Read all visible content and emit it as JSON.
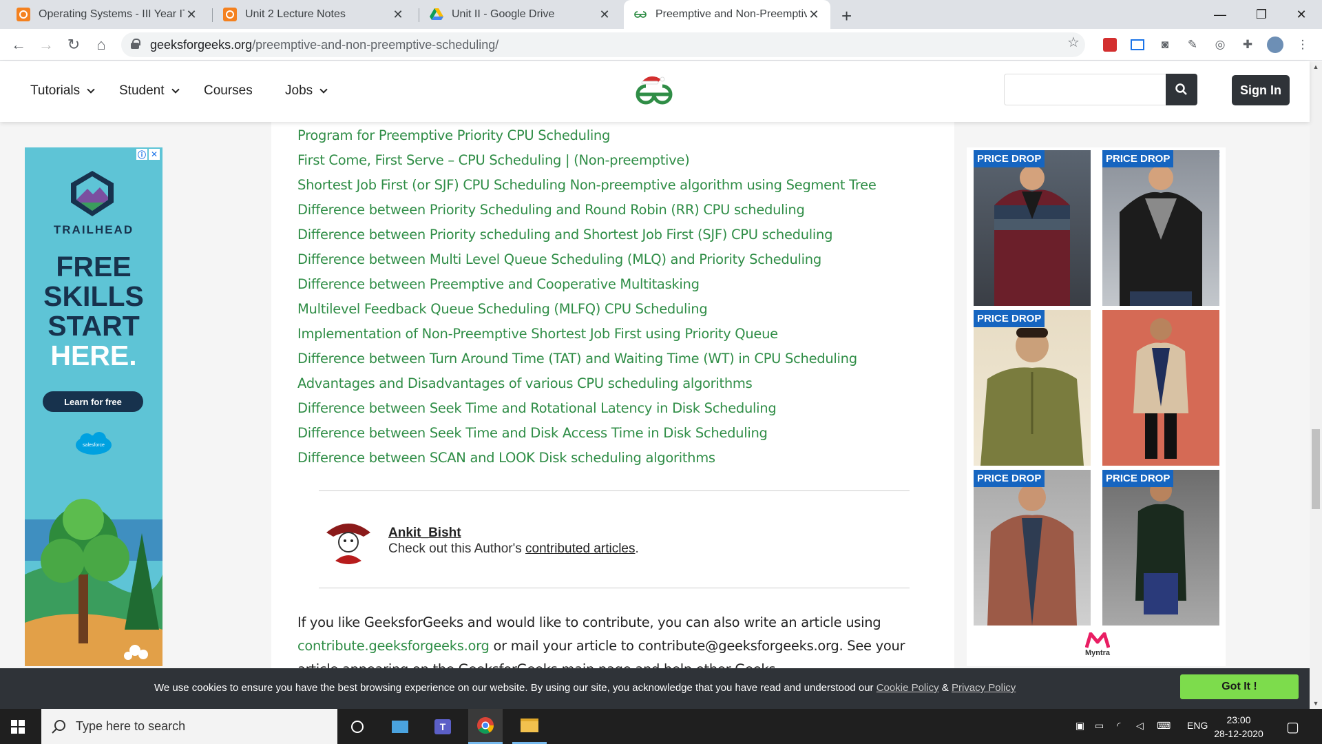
{
  "browser": {
    "tabs": [
      {
        "title": "Operating Systems - III Year IT (B",
        "icon": "classroom-icon"
      },
      {
        "title": "Unit 2 Lecture Notes",
        "icon": "classroom-icon"
      },
      {
        "title": "Unit II - Google Drive",
        "icon": "drive-icon"
      },
      {
        "title": "Preemptive and Non-Preemptive",
        "icon": "gfg-icon",
        "active": true
      }
    ],
    "url_domain": "geeksforgeeks.org",
    "url_path": "/preemptive-and-non-preemptive-scheduling/"
  },
  "header": {
    "nav": [
      "Tutorials",
      "Student",
      "Courses",
      "Jobs"
    ],
    "search_placeholder": "",
    "signin_label": "Sign In"
  },
  "article": {
    "related_links": [
      "Program for Preemptive Priority CPU Scheduling",
      "First Come, First Serve – CPU Scheduling | (Non-preemptive)",
      "Shortest Job First (or SJF) CPU Scheduling Non-preemptive algorithm using Segment Tree",
      "Difference between Priority Scheduling and Round Robin (RR) CPU scheduling",
      "Difference between Priority scheduling and Shortest Job First (SJF) CPU scheduling",
      "Difference between Multi Level Queue Scheduling (MLQ) and Priority Scheduling",
      "Difference between Preemptive and Cooperative Multitasking",
      "Multilevel Feedback Queue Scheduling (MLFQ) CPU Scheduling",
      "Implementation of Non-Preemptive Shortest Job First using Priority Queue",
      "Difference between Turn Around Time (TAT) and Waiting Time (WT) in CPU Scheduling",
      "Advantages and Disadvantages of various CPU scheduling algorithms",
      "Difference between Seek Time and Rotational Latency in Disk Scheduling",
      "Difference between Seek Time and Disk Access Time in Disk Scheduling",
      "Difference between SCAN and LOOK Disk scheduling algorithms"
    ],
    "author_name": "Ankit_Bisht",
    "author_text_pre": "Check out this Author's ",
    "author_link": "contributed articles",
    "author_text_post": ".",
    "contrib_pre": "If you like GeeksforGeeks and would like to contribute, you can also write an article using ",
    "contrib_link": "contribute.geeksforgeeks.org",
    "contrib_post": " or mail your article to contribute@geeksforgeeks.org. See your article appearing on the GeeksforGeeks main page and help other Geeks."
  },
  "ad_left": {
    "brand": "TRAILHEAD",
    "headline": [
      "FREE",
      "SKILLS",
      "START",
      "HERE."
    ],
    "cta": "Learn for free",
    "sponsor": "salesforce"
  },
  "ad_right": {
    "badge": "PRICE DROP",
    "brand": "Myntra"
  },
  "cookie": {
    "text": "We use cookies to ensure you have the best browsing experience on our website. By using our site, you acknowledge that you have read and understood our ",
    "policy1": "Cookie Policy",
    "amp": " & ",
    "policy2": "Privacy Policy",
    "button": "Got It !"
  },
  "taskbar": {
    "search_placeholder": "Type here to search",
    "lang": "ENG",
    "time": "23:00",
    "date": "28-12-2020"
  },
  "colors": {
    "gfg_green": "#2f8d46",
    "dark": "#2f3338",
    "cookie_button": "#7ddc4c",
    "price_drop": "#1665c0"
  }
}
